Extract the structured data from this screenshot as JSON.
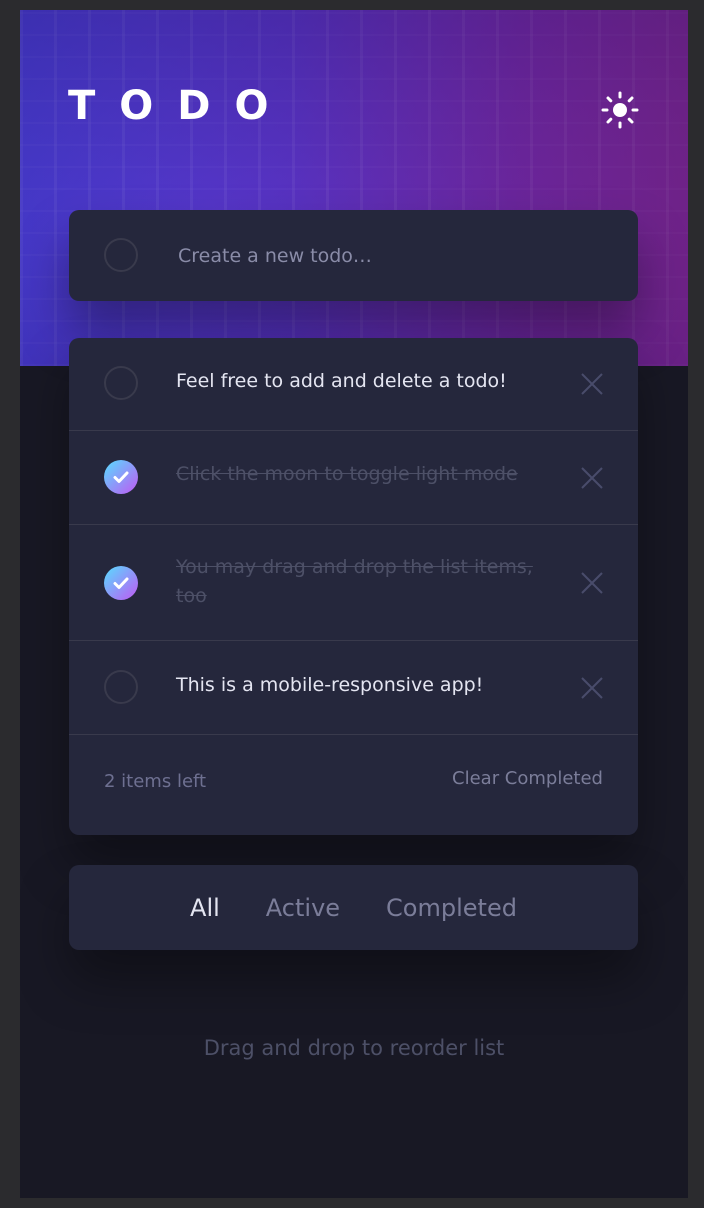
{
  "app": {
    "title": "TODO"
  },
  "colors": {
    "background": "#181824",
    "card": "#25273c",
    "divider": "#393a4c",
    "text": "#e4e5f1",
    "muted": "#7b7d99",
    "completed_text": "#4d5067",
    "check_gradient_start": "#57ddff",
    "check_gradient_end": "#c058f3",
    "hero_start": "#4a3dd4",
    "hero_end": "#8c2a9a"
  },
  "new_todo": {
    "placeholder": "Create a new todo…"
  },
  "todos": [
    {
      "text": "Feel free to add and delete a todo!",
      "completed": false
    },
    {
      "text": "Click the moon to toggle light mode",
      "completed": true
    },
    {
      "text": "You may drag and drop the list items, too",
      "completed": true
    },
    {
      "text": "This is a mobile-responsive app!",
      "completed": false
    }
  ],
  "footer": {
    "items_left": "2 items left",
    "clear_completed": "Clear Completed"
  },
  "filters": {
    "all": "All",
    "active": "Active",
    "completed": "Completed",
    "selected": "All"
  },
  "hint": "Drag and drop to reorder list",
  "icons": {
    "theme_toggle": "sun-icon",
    "delete": "close-icon",
    "check": "check-icon"
  }
}
